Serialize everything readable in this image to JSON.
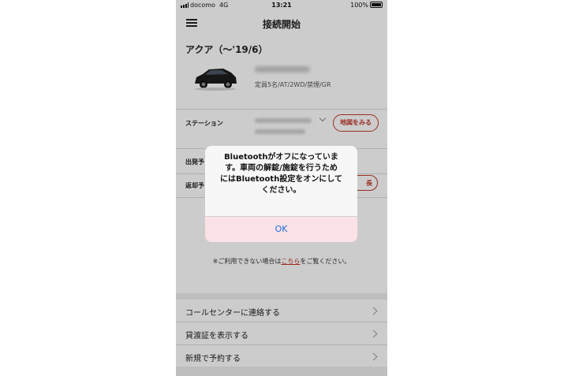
{
  "status_bar": {
    "carrier": "docomo",
    "network": "4G",
    "time": "13:21",
    "battery": "100%"
  },
  "header": {
    "title": "接続開始"
  },
  "car": {
    "name": "アクア（〜'19/6）",
    "spec": "定員5名/AT/2WD/禁煙/GR"
  },
  "station": {
    "label": "ステーション",
    "map_button": "地図をみる"
  },
  "departure": {
    "label": "出発予"
  },
  "return": {
    "label": "返却予",
    "button_fragment": "長"
  },
  "note": {
    "prefix": "※ご利用できない場合は",
    "link": "こちら",
    "suffix": "をご覧ください。"
  },
  "menu": {
    "items": [
      {
        "label": "コールセンターに連絡する"
      },
      {
        "label": "貸渡証を表示する"
      },
      {
        "label": "新規で予約する"
      }
    ]
  },
  "alert": {
    "lines": [
      "Bluetoothがオフになっていま",
      "す。車両の解錠/施錠を行うため",
      "にはBluetooth設定をオンにして",
      "ください。"
    ],
    "ok_label": "OK"
  },
  "colors": {
    "accent": "#c0392b",
    "link_blue": "#1a6fe0",
    "ok_area": "#fbe2e6"
  }
}
